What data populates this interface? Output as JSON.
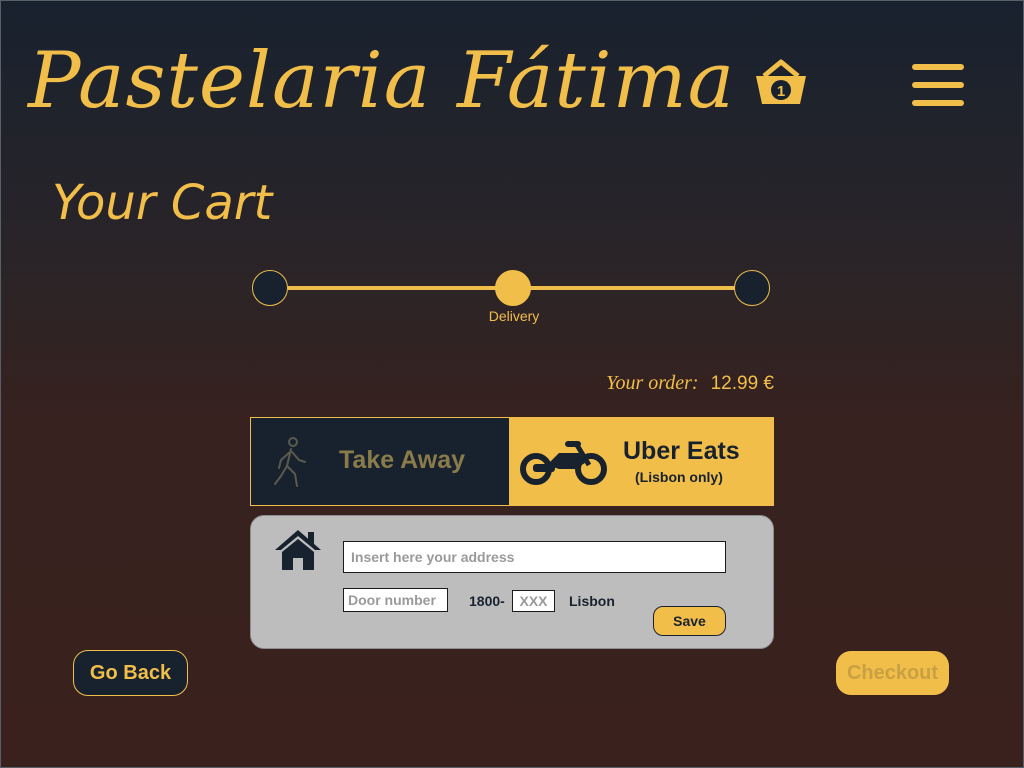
{
  "header": {
    "brand": "Pastelaria Fátima",
    "cart_icon": "basket-icon",
    "cart_count": "1",
    "menu_icon": "hamburger-menu-icon"
  },
  "page": {
    "title": "Your Cart"
  },
  "stepper": {
    "steps": [
      "",
      "Delivery",
      ""
    ],
    "current_step": 2,
    "total_steps": 3
  },
  "order": {
    "label": "Your order:",
    "total": "12.99 €"
  },
  "delivery_options": {
    "take_away": {
      "label": "Take Away",
      "icon": "walking-person-icon",
      "selected": false
    },
    "uber_eats": {
      "label": "Uber Eats",
      "sublabel": "(Lisbon only)",
      "icon": "motorbike-icon",
      "selected": true
    }
  },
  "address_form": {
    "icon": "home-icon",
    "address_placeholder": "Insert here your address",
    "door_placeholder": "Door number",
    "zip_prefix": "1800-",
    "zip_placeholder": "XXX",
    "city": "Lisbon",
    "save_label": "Save"
  },
  "footer": {
    "back_label": "Go Back",
    "checkout_label": "Checkout"
  },
  "colors": {
    "accent": "#f2be4a",
    "navy": "#18222f",
    "background_bottom": "#3a211e",
    "panel": "#bdbdbd"
  }
}
